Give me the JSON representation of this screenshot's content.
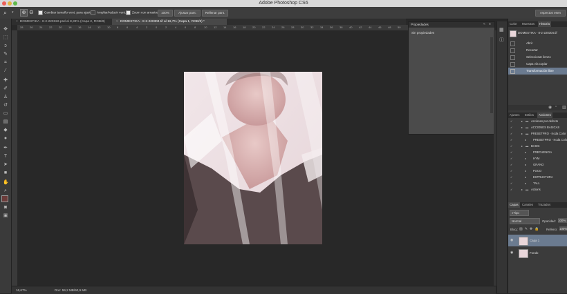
{
  "window": {
    "title": "Adobe Photoshop CS6",
    "right_button": "Aspectos esen"
  },
  "options_bar": {
    "options": [
      {
        "label": "Cambiar tamaño vent. para ajustar",
        "checked": true
      },
      {
        "label": "Ampliar/reducir vent.",
        "checked": false
      },
      {
        "label": "Zoom con arrastre",
        "checked": true
      }
    ],
    "buttons": [
      "100%",
      "Ajustar pant.",
      "Rellenar pant."
    ]
  },
  "document_tabs": [
    {
      "label": "DOMESTIKA - 8-2-220322.psd al 8,33% (Capa 2, RGB/8)",
      "active": false
    },
    {
      "label": "DOMESTIKA - 8-2-220304.tif al 16,7% (Capa 1, RGB/8) *",
      "active": true
    }
  ],
  "ruler_labels": [
    "28",
    "26",
    "24",
    "22",
    "20",
    "18",
    "16",
    "14",
    "12",
    "10",
    "8",
    "6",
    "4",
    "2",
    "0",
    "2",
    "4",
    "6",
    "8",
    "10",
    "12",
    "14",
    "16",
    "18",
    "20",
    "22",
    "24",
    "26",
    "28",
    "30",
    "32",
    "34",
    "36",
    "38",
    "40",
    "42",
    "44",
    "46",
    "48",
    "50"
  ],
  "status_bar": {
    "zoom": "16,67%",
    "doc": "Doc: 59,2 MB/60,9 MB"
  },
  "properties_panel": {
    "title": "Propiedades",
    "empty_text": "Sin propiedades"
  },
  "panels": {
    "top_tabs": [
      "Color",
      "Muestras",
      "Historia"
    ],
    "history": {
      "snapshot": "DOMESTIKA - 8-2-220304.tif",
      "items": [
        {
          "label": "Abrir",
          "selected": false
        },
        {
          "label": "Recortar",
          "selected": false
        },
        {
          "label": "Seleccionar lienzo",
          "selected": false
        },
        {
          "label": "Capa vía copiar",
          "selected": false
        },
        {
          "label": "Transformación libre",
          "selected": true
        }
      ]
    },
    "mid_tabs": [
      "Ajustes",
      "Estilos",
      "Acciones"
    ],
    "actions": [
      {
        "label": "Acciones por defecto",
        "indent": 0,
        "folder": true
      },
      {
        "label": "ACCIONES BASICAS",
        "indent": 0,
        "folder": true
      },
      {
        "label": "PRESETPRO - Koda Color",
        "indent": 0,
        "folder": true
      },
      {
        "label": "PRESETPRO - Koda Color",
        "indent": 1,
        "folder": false
      },
      {
        "label": "BASIC",
        "indent": 0,
        "folder": true
      },
      {
        "label": "FRECUENCIA",
        "indent": 1,
        "folder": false
      },
      {
        "label": "HYM",
        "indent": 1,
        "folder": false
      },
      {
        "label": "GRANO",
        "indent": 1,
        "folder": false
      },
      {
        "label": "FOCO",
        "indent": 1,
        "folder": false
      },
      {
        "label": "ESTRUCTURA",
        "indent": 1,
        "folder": false
      },
      {
        "label": "TALL",
        "indent": 1,
        "folder": false
      },
      {
        "label": "Actions",
        "indent": 0,
        "folder": true
      }
    ],
    "layer_tabs": [
      "Capas",
      "Canales",
      "Trazados"
    ],
    "layers": {
      "filter": "Tipo",
      "blend_mode": "Normal",
      "opacity_label": "Opacidad:",
      "opacity": "100%",
      "lock_label": "Bloq.:",
      "fill_label": "Relleno:",
      "fill": "100%",
      "items": [
        {
          "name": "Capa 1",
          "selected": true
        },
        {
          "name": "Fondo",
          "selected": false
        }
      ]
    }
  },
  "colors": {
    "selection": "#6b7b90",
    "panel": "#3b3b3b",
    "canvas": "#282828"
  }
}
